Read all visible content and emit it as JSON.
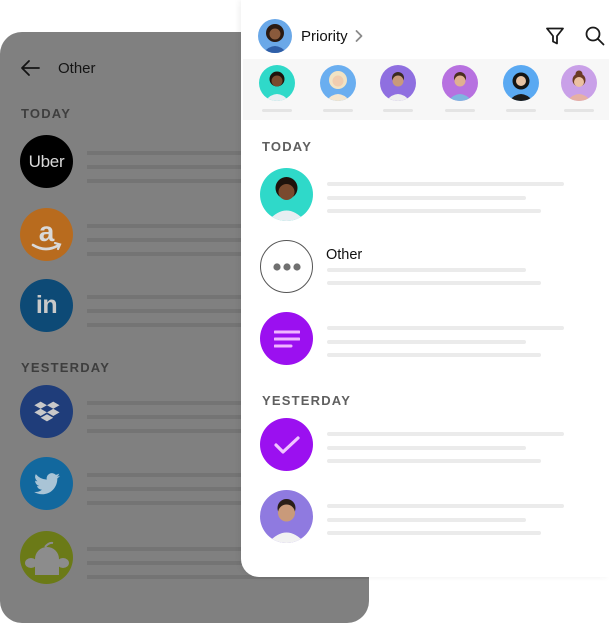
{
  "back_panel": {
    "title": "Other",
    "back_icon": "arrow-left-icon",
    "sections": [
      {
        "label": "TODAY",
        "items": [
          {
            "name": "Uber",
            "logo_text": "Uber",
            "icon": "uber-logo-icon",
            "color": "#000000"
          },
          {
            "name": "Amazon",
            "logo_text": "a",
            "icon": "amazon-logo-icon",
            "color": "#b86b1e"
          },
          {
            "name": "LinkedIn",
            "logo_text": "in",
            "icon": "linkedin-logo-icon",
            "color": "#0d4a76"
          }
        ]
      },
      {
        "label": "YESTERDAY",
        "items": [
          {
            "name": "Dropbox",
            "logo_text": "",
            "icon": "dropbox-logo-icon",
            "color": "#1f3d7a"
          },
          {
            "name": "Twitter",
            "logo_text": "",
            "icon": "twitter-logo-icon",
            "color": "#12689e"
          },
          {
            "name": "SurveyMonkey",
            "logo_text": "",
            "icon": "surveymonkey-logo-icon",
            "color": "#6b7a17"
          }
        ]
      }
    ]
  },
  "front_panel": {
    "title": "Priority",
    "profile_avatar_color": "#6aa8e8",
    "toolbar": {
      "filter_icon": "filter-icon",
      "search_icon": "search-icon"
    },
    "priority_contacts": [
      {
        "avatar_color": "#2fd9c9"
      },
      {
        "avatar_color": "#6aaef0"
      },
      {
        "avatar_color": "#8f6fe0"
      },
      {
        "avatar_color": "#b771e0"
      },
      {
        "avatar_color": "#5aa9f2"
      },
      {
        "avatar_color": "#c9a0e8"
      }
    ],
    "sections": [
      {
        "label": "TODAY",
        "items": [
          {
            "type": "person",
            "title": "",
            "avatar_color": "#2fd9c9"
          },
          {
            "type": "other",
            "title": "Other",
            "icon": "more-dots-icon"
          },
          {
            "type": "notes",
            "title": "",
            "icon": "notes-lines-icon",
            "color": "#9b10f0"
          }
        ]
      },
      {
        "label": "YESTERDAY",
        "items": [
          {
            "type": "done",
            "title": "",
            "icon": "checkmark-icon",
            "color": "#9b10f0"
          },
          {
            "type": "person",
            "title": "",
            "avatar_color": "#8f7ae0"
          }
        ]
      }
    ]
  }
}
